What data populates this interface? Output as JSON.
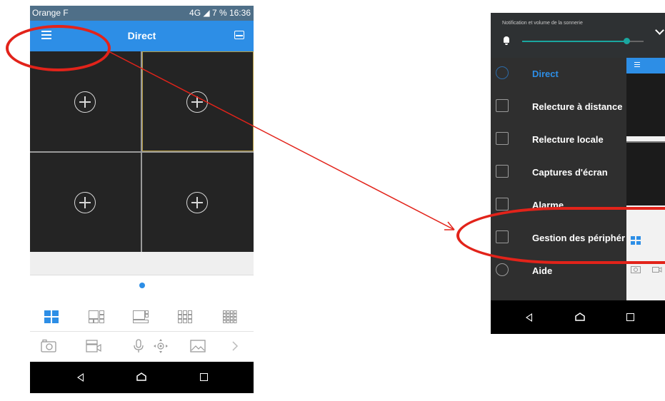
{
  "left_phone": {
    "status_bar": {
      "carrier": "Orange F",
      "right_info": "4G ◢ 7 % 16:36"
    },
    "app_bar": {
      "title": "Direct",
      "menu_icon": "hamburger-icon",
      "device_icon": "hard-drive-icon"
    },
    "camera_grid": {
      "rows": 2,
      "columns": 2,
      "cell_icon": "add-camera-icon",
      "selected_cell": 2
    },
    "layout_options": [
      "1-view",
      "6-view",
      "8-view",
      "9-view",
      "16-view"
    ],
    "selected_layout": "1-view",
    "toolbar": [
      "camera-snapshot-icon",
      "record-icon",
      "microphone-icon",
      "ptz-icon",
      "image-icon",
      "chevron-right-icon"
    ],
    "nav_bar": [
      "back-icon",
      "home-icon",
      "recent-apps-icon"
    ]
  },
  "right_phone": {
    "notification_shade": {
      "title": "Notification et volume de la sonnerie",
      "volume_level": 0.85
    },
    "drawer": {
      "items": [
        {
          "label": "Direct",
          "icon": "live-view-icon",
          "active": true
        },
        {
          "label": "Relecture à distance",
          "icon": "remote-playback-icon",
          "active": false
        },
        {
          "label": "Relecture locale",
          "icon": "local-playback-icon",
          "active": false
        },
        {
          "label": "Captures d'écran",
          "icon": "screenshots-icon",
          "active": false
        },
        {
          "label": "Alarme",
          "icon": "alarm-icon",
          "active": false
        },
        {
          "label": "Gestion des périphér",
          "icon": "device-manager-icon",
          "active": false
        },
        {
          "label": "Aide",
          "icon": "help-icon",
          "active": false
        }
      ]
    },
    "nav_bar": [
      "back-icon",
      "home-icon",
      "recent-apps-icon"
    ]
  },
  "annotations": {
    "color": "#e2231a",
    "highlight_shape": "ellipse",
    "connector": "arrow"
  },
  "colors": {
    "accent": "#2d8ee6",
    "drawer_bg": "#2f2f2f",
    "grid_bg": "#242424",
    "annotation": "#e2231a"
  }
}
